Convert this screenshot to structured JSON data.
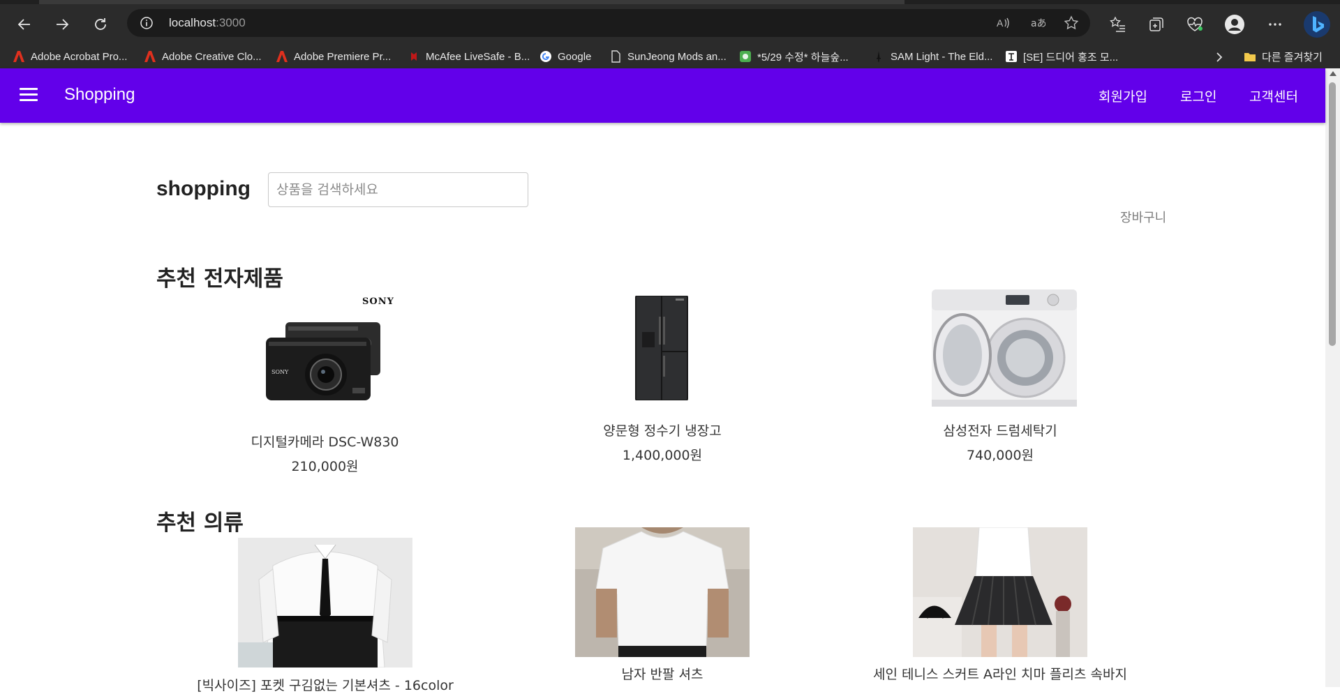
{
  "browser": {
    "url_host": "localhost",
    "url_port": ":3000",
    "bookmarks": [
      {
        "label": "Adobe Acrobat Pro...",
        "icon": "adobe-icon"
      },
      {
        "label": "Adobe Creative Clo...",
        "icon": "adobe-icon"
      },
      {
        "label": "Adobe Premiere Pr...",
        "icon": "adobe-icon"
      },
      {
        "label": "McAfee LiveSafe - B...",
        "icon": "mcafee-icon"
      },
      {
        "label": "Google",
        "icon": "google-icon"
      },
      {
        "label": "SunJeong Mods an...",
        "icon": "page-icon"
      },
      {
        "label": "*5/29 수정* 하늘숲...",
        "icon": "green-app-icon"
      },
      {
        "label": "SAM Light - The Eld...",
        "icon": "sword-icon"
      },
      {
        "label": "[SE] 드디어 홍조 모...",
        "icon": "notion-icon"
      }
    ],
    "other_favorites": "다른 즐겨찾기"
  },
  "appbar": {
    "title": "Shopping",
    "links": [
      "회원가입",
      "로그인",
      "고객센터"
    ]
  },
  "main": {
    "brand": "shopping",
    "search_placeholder": "상품을 검색하세요",
    "cart_label": "장바구니"
  },
  "sections": {
    "electronics": {
      "title": "추천 전자제품",
      "items": [
        {
          "name": "디지털카메라 DSC-W830",
          "price": "210,000원",
          "image": "camera",
          "logo_text": "SONY"
        },
        {
          "name": "양문형 정수기 냉장고",
          "price": "1,400,000원",
          "image": "refrigerator"
        },
        {
          "name": "삼성전자 드럼세탁기",
          "price": "740,000원",
          "image": "washing-machine"
        }
      ]
    },
    "clothing": {
      "title": "추천 의류",
      "items": [
        {
          "name": "[빅사이즈] 포켓 구김없는 기본셔츠 - 16color",
          "image": "dress-shirt"
        },
        {
          "name": "남자 반팔 셔츠",
          "image": "tshirt"
        },
        {
          "name": "세인 테니스 스커트 A라인 치마 플리츠 속바지",
          "image": "tennis-skirt"
        }
      ]
    }
  },
  "colors": {
    "appbar": "#6200ea",
    "chrome_dark": "#2b2b2b"
  }
}
